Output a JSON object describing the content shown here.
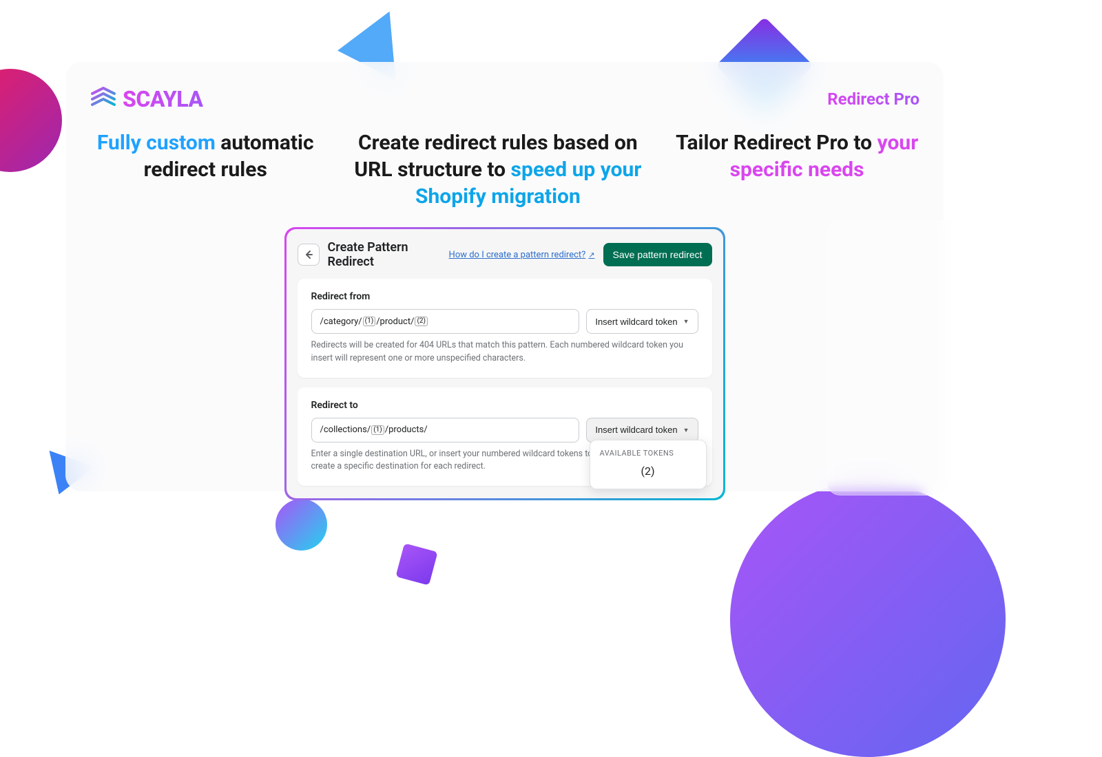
{
  "brand": {
    "name": "SCAYLA",
    "product": "Redirect Pro"
  },
  "columns": {
    "c1": {
      "accent": "Fully custom",
      "rest": "automatic redirect rules"
    },
    "c2": {
      "lead": "Create redirect rules based on URL structure to ",
      "accent": "speed up your Shopify migration"
    },
    "c3": {
      "lead": "Tailor Redirect Pro to ",
      "accent": "your specific needs"
    }
  },
  "dialog": {
    "title": "Create Pattern Redirect",
    "help_link": "How do I create a pattern redirect?",
    "save_button": "Save pattern redirect",
    "from": {
      "label": "Redirect from",
      "value_prefix": "/category/",
      "value_mid": "/product/",
      "token1": "1",
      "token2": "2",
      "help": "Redirects will be created for 404 URLs that match this pattern. Each numbered wildcard token you insert will represent one or more unspecified characters."
    },
    "to": {
      "label": "Redirect to",
      "value_prefix": "/collections/",
      "value_suffix": "/products/",
      "token1": "1",
      "help": "Enter a single destination URL, or insert your numbered wildcard tokens to create a specific destination for each redirect."
    },
    "wildcard_button": "Insert wildcard token",
    "popover": {
      "label": "AVAILABLE TOKENS",
      "token": "(2)"
    }
  }
}
